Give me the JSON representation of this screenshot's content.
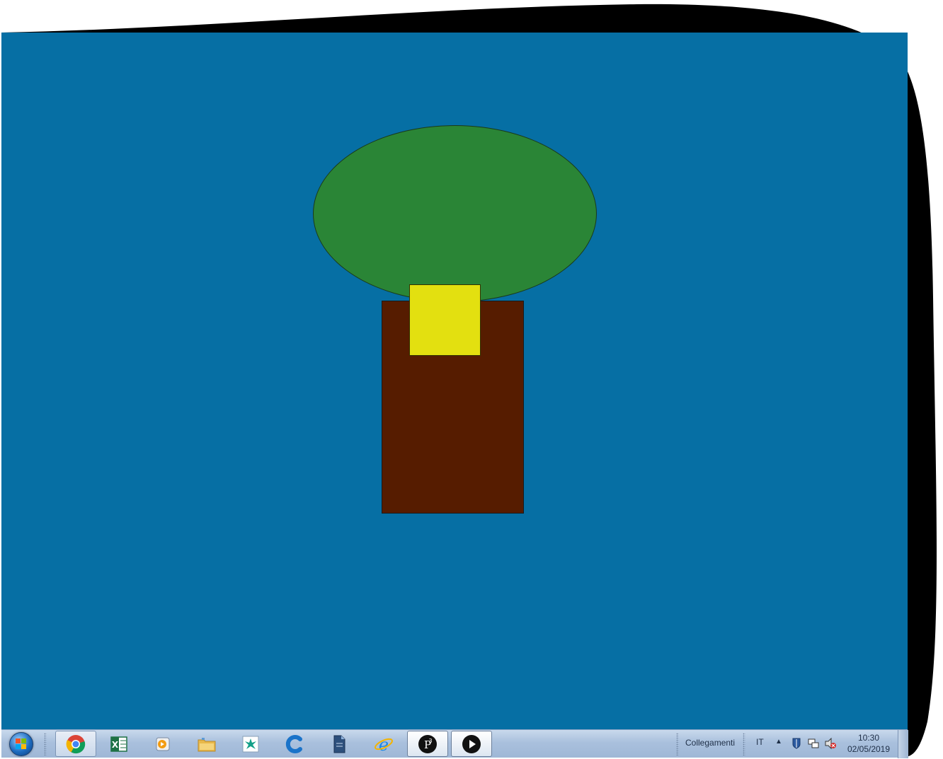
{
  "colors": {
    "desktop_background": "#066fa4",
    "tree_crown": "#2a8536",
    "tree_trunk": "#561c00",
    "yellow_square": "#e3e010"
  },
  "taskbar": {
    "items": [
      {
        "name": "chrome",
        "icon": "chrome-icon"
      },
      {
        "name": "excel",
        "icon": "excel-icon"
      },
      {
        "name": "media-player",
        "icon": "media-player-icon"
      },
      {
        "name": "file-explorer",
        "icon": "folder-icon"
      },
      {
        "name": "app",
        "icon": "green-leaf-app-icon"
      },
      {
        "name": "ccleaner",
        "icon": "c-app-icon"
      },
      {
        "name": "document-app",
        "icon": "document-icon"
      },
      {
        "name": "internet-explorer",
        "icon": "internet-explorer-icon"
      },
      {
        "name": "p3-app",
        "icon": "p3-icon"
      },
      {
        "name": "player-app",
        "icon": "play-icon"
      }
    ],
    "links_label": "Collegamenti",
    "language": "IT",
    "tray_arrow": "▲",
    "clock_time": "10:30",
    "clock_date": "02/05/2019"
  }
}
